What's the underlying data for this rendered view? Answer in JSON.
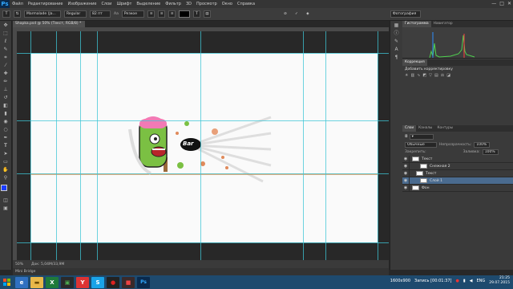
{
  "app": {
    "logo": "Ps",
    "accent": "#31a8ff"
  },
  "menu": [
    "Файл",
    "Редактирование",
    "Изображение",
    "Слои",
    "Шрифт",
    "Выделение",
    "Фильтр",
    "3D",
    "Просмотр",
    "Окно",
    "Справка"
  ],
  "window_controls": [
    "—",
    "□",
    "✕"
  ],
  "options": {
    "font_family": "Marmalade (Ja...",
    "font_style": "Regular",
    "font_size": "82 пт",
    "antialias_label": "Аа",
    "antialias": "Резкое",
    "workspace": "Фотография"
  },
  "document": {
    "tab_title": "Shapka.psd @ 50% (Текст, RGB/8) *",
    "zoom": "50%",
    "doc_info": "Док: 5,04M/33,9M",
    "canvas_logo_text": "Bar"
  },
  "mini_bridge": "Mini Bridge",
  "panels": {
    "histogram_tabs": [
      "Гистограмма",
      "Навигатор"
    ],
    "adjustments_tabs": [
      "Коррекция"
    ],
    "adjustments_title": "Добавить корректировку",
    "layers_tabs": [
      "Слои",
      "Каналы",
      "Контуры"
    ],
    "blend_mode": "Обычные",
    "opacity_label": "Непрозрачность:",
    "opacity": "100%",
    "lock_label": "Закрепить:",
    "fill_label": "Заливка:",
    "fill": "100%",
    "layers": [
      {
        "name": "Текст",
        "selected": false,
        "indent": 0
      },
      {
        "name": "Снежная 2",
        "selected": false,
        "indent": 2
      },
      {
        "name": "Текст",
        "selected": false,
        "indent": 1
      },
      {
        "name": "Слой 1",
        "selected": true,
        "indent": 2
      },
      {
        "name": "Фон",
        "selected": false,
        "indent": 0
      }
    ]
  },
  "taskbar": {
    "record_label": "Запись [00:01:37]",
    "resolution": "1600x900",
    "lang": "ENG",
    "time": "21:25",
    "date": "29.07.2015"
  }
}
